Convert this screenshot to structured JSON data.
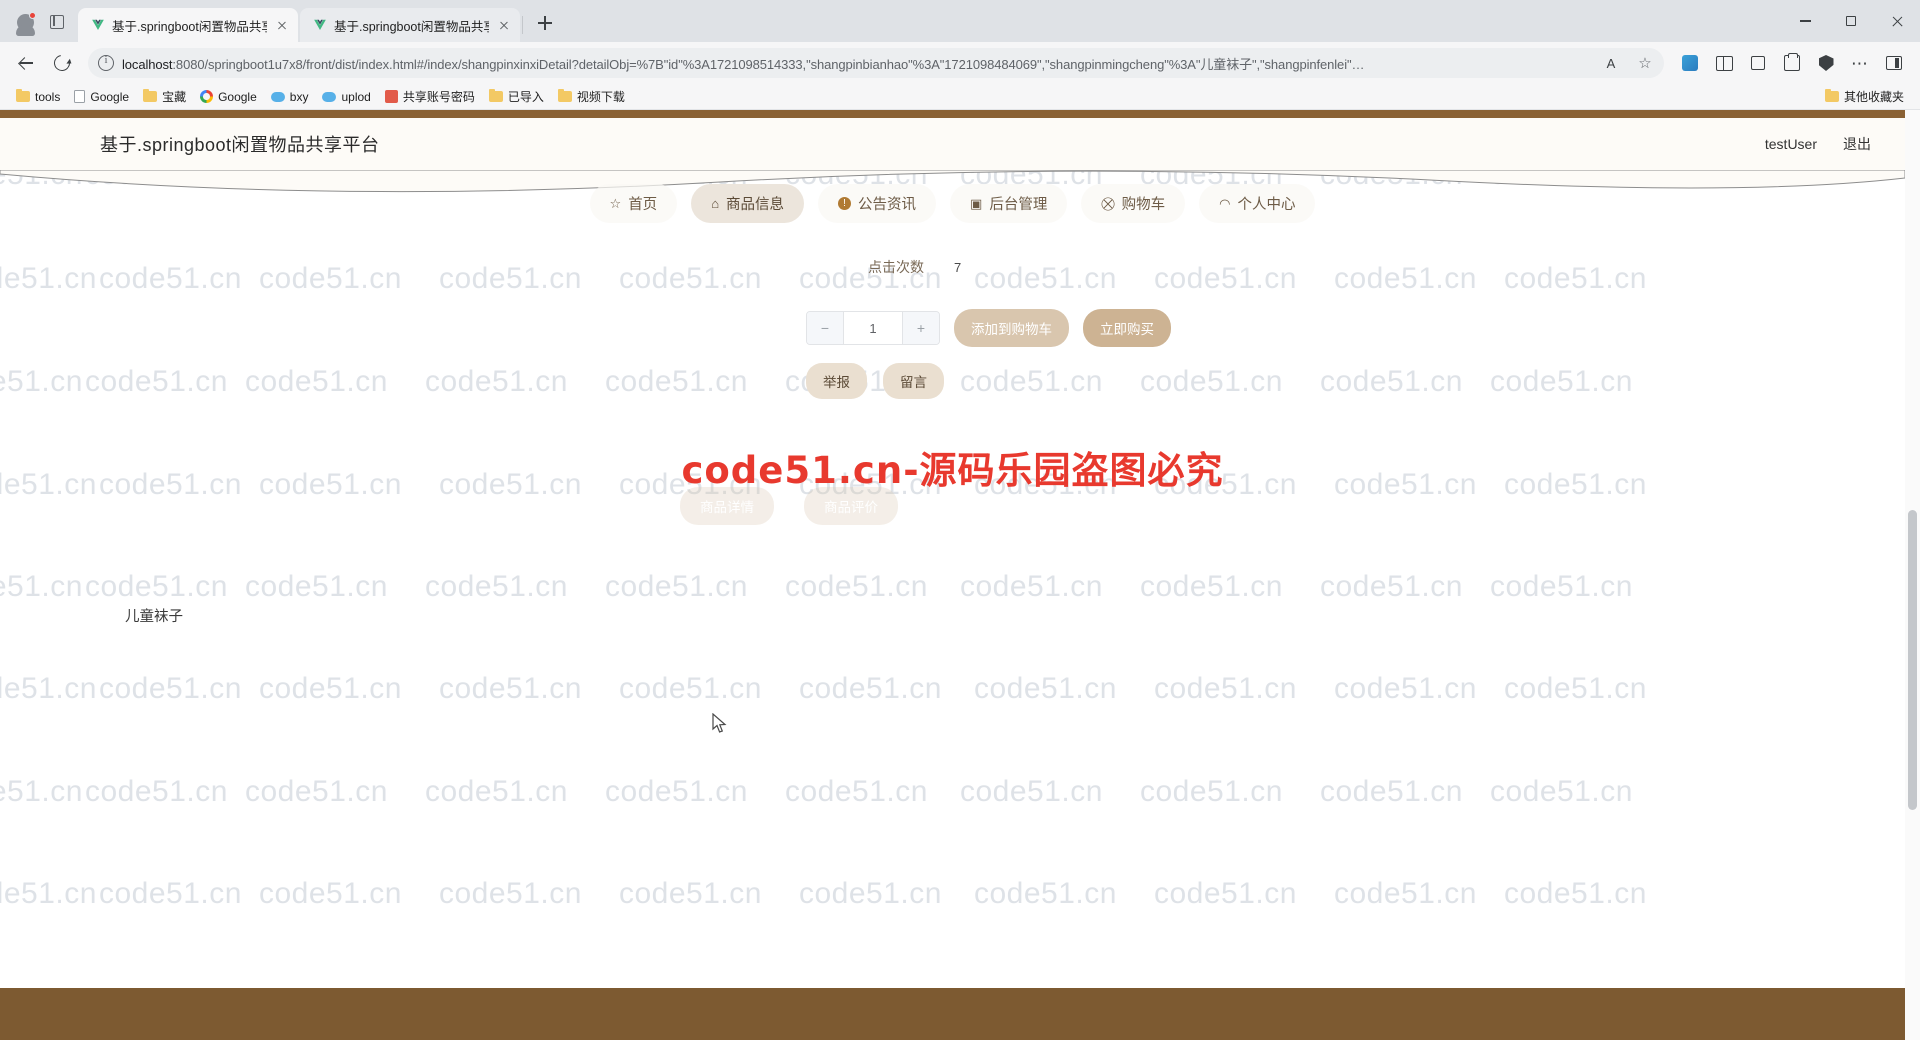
{
  "browser": {
    "tabs": [
      {
        "title": "基于.springboot闲置物品共享平…",
        "active": true
      },
      {
        "title": "基于.springboot闲置物品共享平…",
        "active": false
      }
    ],
    "newtab_label": "+",
    "url_host": "localhost",
    "url_rest": ":8080/springboot1u7x8/front/dist/index.html#/index/shangpinxinxiDetail?detailObj=%7B\"id\"%3A1721098514333,\"shangpinbianhao\"%3A\"1721098484069\",\"shangpinmingcheng\"%3A\"儿童袜子\",\"shangpinfenlei\"…",
    "reading_view_label": "A",
    "bookmarks": [
      {
        "label": "tools",
        "icon": "folder-icon"
      },
      {
        "label": "Google",
        "icon": "page-icon"
      },
      {
        "label": "宝藏",
        "icon": "folder-icon"
      },
      {
        "label": "Google",
        "icon": "google-icon"
      },
      {
        "label": "bxy",
        "icon": "cloud-icon"
      },
      {
        "label": "uplod",
        "icon": "cloud-icon"
      },
      {
        "label": "共享账号密码",
        "icon": "blue-square-icon"
      },
      {
        "label": "已导入",
        "icon": "folder-icon"
      },
      {
        "label": "视频下载",
        "icon": "folder-icon"
      }
    ],
    "other_bookmarks": "其他收藏夹",
    "window_controls": {
      "minimize": "minimize-icon",
      "maximize": "maximize-icon",
      "close": "close-icon"
    }
  },
  "site": {
    "title": "基于.springboot闲置物品共享平台",
    "user": "testUser",
    "logout": "退出",
    "accent_brown": "#8a6134",
    "footer_brown": "#7d5a31",
    "nav": [
      {
        "label": "首页",
        "icon": "star-icon",
        "active": false
      },
      {
        "label": "商品信息",
        "icon": "tag-icon",
        "active": true
      },
      {
        "label": "公告资讯",
        "icon": "alert-icon",
        "active": false
      },
      {
        "label": "后台管理",
        "icon": "window-icon",
        "active": false
      },
      {
        "label": "购物车",
        "icon": "cart-icon",
        "active": false
      },
      {
        "label": "个人中心",
        "icon": "user-icon",
        "active": false
      }
    ]
  },
  "detail": {
    "clicks_label": "点击次数",
    "clicks_value": "7",
    "quantity": "1",
    "minus": "−",
    "plus": "+",
    "add_to_cart": "添加到购物车",
    "buy_now": "立即购买",
    "report": "举报",
    "message": "留言",
    "ghost_left": "商品详情",
    "ghost_right": "商品评价",
    "product_name": "儿童袜子"
  },
  "overlay": {
    "banner": "code51.cn-源码乐园盗图必究",
    "banner_color": "#e8392e",
    "watermark_text": "code51.cn"
  }
}
